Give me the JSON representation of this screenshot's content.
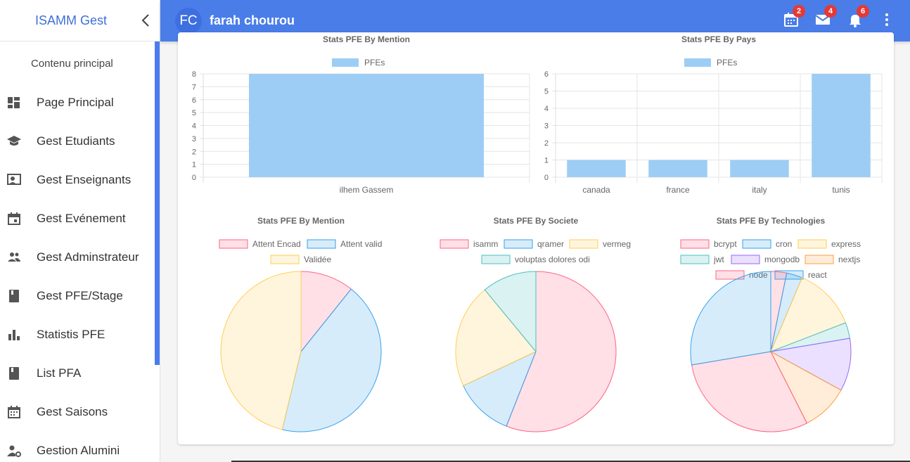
{
  "sidebar": {
    "brand": "ISAMM Gest",
    "section_title": "Contenu principal",
    "items": [
      {
        "label": "Page Principal",
        "icon": "dashboard-icon"
      },
      {
        "label": "Gest Etudiants",
        "icon": "school-icon"
      },
      {
        "label": "Gest Enseignants",
        "icon": "teacher-icon"
      },
      {
        "label": "Gest Evénement",
        "icon": "calendar-icon"
      },
      {
        "label": "Gest Adminstrateur",
        "icon": "people-icon"
      },
      {
        "label": "Gest PFE/Stage",
        "icon": "book-icon"
      },
      {
        "label": "Statistis PFE",
        "icon": "bar-chart-icon"
      },
      {
        "label": "List PFA",
        "icon": "book-icon"
      },
      {
        "label": "Gest Saisons",
        "icon": "calendar-grid-icon"
      },
      {
        "label": "Gestion Alumini",
        "icon": "person-gear-icon"
      }
    ]
  },
  "topbar": {
    "avatar_initials": "FC",
    "username": "farah chourou",
    "badges": {
      "calendar": "2",
      "mail": "4",
      "notifications": "6"
    }
  },
  "colors": {
    "primary": "#4a7de8",
    "bar_fill": "#9dcdf4",
    "pink": "#ff6384",
    "blue": "#36a2eb",
    "yellow": "#ffcd56",
    "teal": "#4bc0c0",
    "purple": "#9966ff",
    "orange": "#ff9f40"
  },
  "chart_data": [
    {
      "type": "bar",
      "title": "Stats PFE By Mention",
      "legend": [
        "PFEs"
      ],
      "categories": [
        "ilhem Gassem"
      ],
      "series": [
        {
          "name": "PFEs",
          "values": [
            8
          ]
        }
      ],
      "ylim": [
        0,
        8
      ],
      "yticks": [
        0,
        1,
        2,
        3,
        4,
        5,
        6,
        7,
        8
      ]
    },
    {
      "type": "bar",
      "title": "Stats PFE By Pays",
      "legend": [
        "PFEs"
      ],
      "categories": [
        "canada",
        "france",
        "italy",
        "tunis"
      ],
      "series": [
        {
          "name": "PFEs",
          "values": [
            1,
            1,
            1,
            6
          ]
        }
      ],
      "ylim": [
        0,
        6
      ],
      "yticks": [
        0,
        1,
        2,
        3,
        4,
        5,
        6
      ]
    },
    {
      "type": "pie",
      "title": "Stats PFE By Mention",
      "labels": [
        "Attent Encad",
        "Attent valid",
        "Validée"
      ],
      "values": [
        1,
        4,
        4.3
      ]
    },
    {
      "type": "pie",
      "title": "Stats PFE By Societe",
      "labels": [
        "isamm",
        "qramer",
        "vermeg",
        "voluptas dolores odi"
      ],
      "values": [
        5.6,
        1.2,
        2.1,
        1.1
      ]
    },
    {
      "type": "pie",
      "title": "Stats PFE By Technologies",
      "labels": [
        "bcrypt",
        "cron",
        "express",
        "jwt",
        "mongodb",
        "nextjs",
        "node",
        "react"
      ],
      "values": [
        0.3,
        0.3,
        1.2,
        0.3,
        1,
        0.9,
        2.8,
        2.6
      ]
    }
  ]
}
